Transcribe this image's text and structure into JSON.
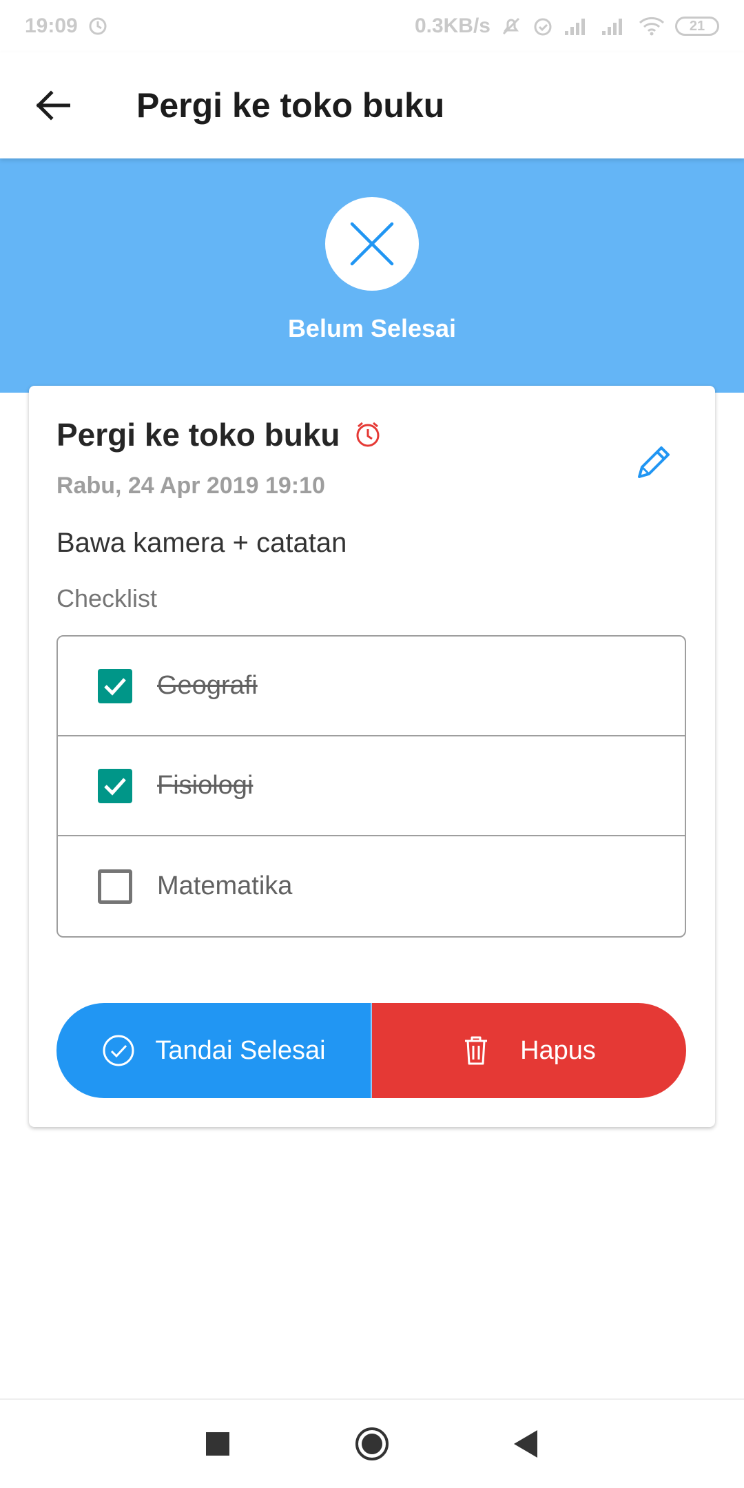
{
  "status_bar": {
    "time": "19:09",
    "network_speed": "0.3KB/s",
    "battery": "21"
  },
  "app_bar": {
    "title": "Pergi ke toko buku"
  },
  "header": {
    "status_icon": "close-icon",
    "status_label": "Belum Selesai",
    "background_color": "#64b5f6"
  },
  "task": {
    "title": "Pergi ke toko buku",
    "date": "Rabu, 24 Apr 2019 19:10",
    "description": "Bawa kamera + catatan",
    "checklist_label": "Checklist",
    "checklist": [
      {
        "label": "Geografi",
        "checked": true
      },
      {
        "label": "Fisiologi",
        "checked": true
      },
      {
        "label": "Matematika",
        "checked": false
      }
    ]
  },
  "actions": {
    "mark_done_label": "Tandai Selesai",
    "delete_label": "Hapus",
    "mark_done_color": "#2196f3",
    "delete_color": "#e53935"
  },
  "colors": {
    "check_color": "#009688",
    "alarm_color": "#e53935",
    "edit_color": "#2196f3"
  }
}
